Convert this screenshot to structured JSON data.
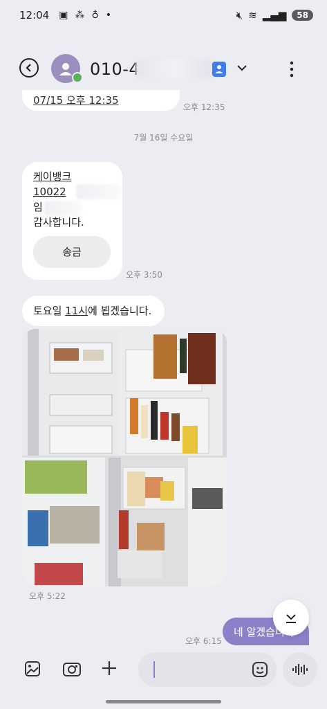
{
  "status_bar": {
    "time": "12:04",
    "battery": "58"
  },
  "header": {
    "contact": "010-4"
  },
  "messages": [
    {
      "id": "m1",
      "text": "07/15 오후 12:35",
      "time": "오후 12:35"
    },
    {
      "id": "day",
      "text": "7월 16일 수요일"
    },
    {
      "id": "m2",
      "lines": [
        "케이뱅크",
        "10022",
        "임",
        "감사합니다."
      ],
      "button": "송금",
      "time": "오후 3:50"
    },
    {
      "id": "m3",
      "text_a": "토요일 ",
      "text_u": "11시",
      "text_b": "에  뵙겠습니다.",
      "time": "오후 5:22"
    },
    {
      "id": "m4",
      "text": "네 알겠습니다",
      "time": "오후 6:15"
    }
  ],
  "colors": {
    "accent": "#8e7fc9",
    "background": "#ececf3",
    "bubble_in": "#ffffff"
  }
}
